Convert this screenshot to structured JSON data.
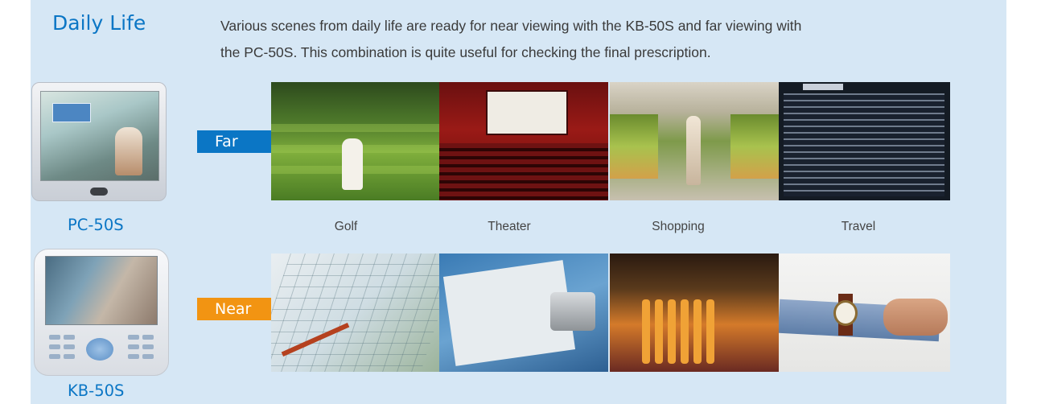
{
  "section": {
    "title": "Daily Life",
    "description_line1": "Various scenes from daily life are ready for near viewing with the KB-50S and far viewing with",
    "description_line2": "the PC-50S.  This combination is quite useful for checking the final prescription."
  },
  "far": {
    "tag": "Far",
    "device_label": "PC-50S",
    "scenes": [
      {
        "caption": "Golf",
        "image": "golf-course-photo"
      },
      {
        "caption": "Theater",
        "image": "theater-photo"
      },
      {
        "caption": "Shopping",
        "image": "supermarket-photo"
      },
      {
        "caption": "Travel",
        "image": "departures-board-photo"
      }
    ]
  },
  "near": {
    "tag": "Near",
    "device_label": "KB-50S",
    "scenes": [
      {
        "image": "golf-scorecard-photo"
      },
      {
        "image": "concert-ticket-photo"
      },
      {
        "image": "produce-market-photo"
      },
      {
        "image": "wristwatch-photo"
      }
    ]
  },
  "colors": {
    "panel_background": "#d6e7f5",
    "accent_blue": "#0b76c5",
    "accent_orange": "#f29412",
    "body_text": "#3a3a3a"
  }
}
